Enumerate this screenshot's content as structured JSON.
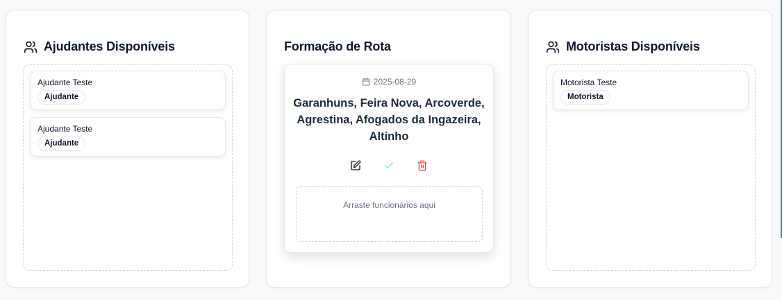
{
  "helpers_panel": {
    "title": "Ajudantes Disponíveis",
    "icon": "users-icon",
    "employees": [
      {
        "name": "Ajudante Teste",
        "role": "Ajudante"
      },
      {
        "name": "Ajudante Teste",
        "role": "Ajudante"
      }
    ]
  },
  "route_panel": {
    "title": "Formação de Rota",
    "route": {
      "date": "2025-08-29",
      "cities": "Garanhuns, Feira Nova, Arcoverde, Agrestina, Afogados da Ingazeira, Altinho",
      "actions": [
        "edit-icon",
        "check-icon",
        "trash-icon"
      ],
      "drop_hint": "Arraste funcionários aqui"
    }
  },
  "drivers_panel": {
    "title": "Motoristas Disponíveis",
    "icon": "users-icon",
    "employees": [
      {
        "name": "Motorista Teste",
        "role": "Motorista"
      }
    ]
  },
  "colors": {
    "edit": "#111827",
    "confirm": "#86efac",
    "delete": "#ef4444",
    "border": "#e5e7eb",
    "dashed": "#d1d5db"
  }
}
